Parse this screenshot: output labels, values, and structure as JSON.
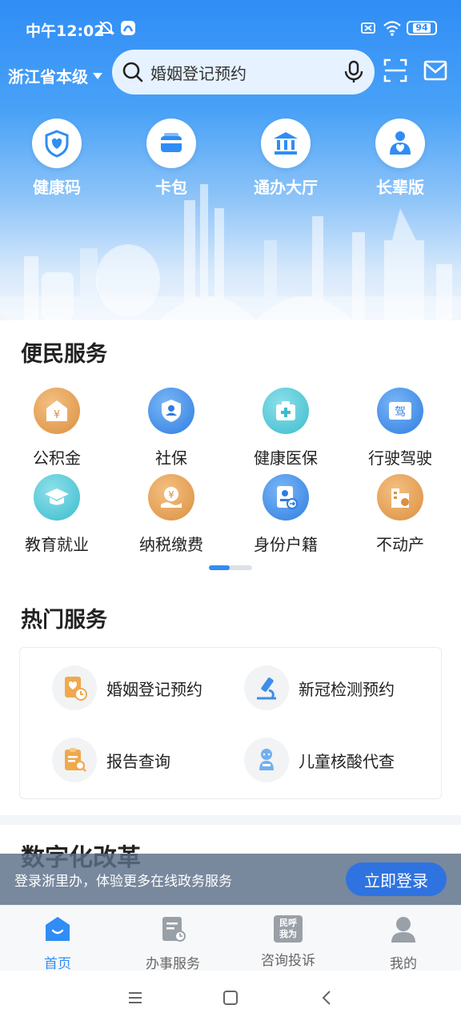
{
  "statusbar": {
    "time": "中午12:02",
    "battery": "94"
  },
  "header": {
    "region": "浙江省本级",
    "search_placeholder": "婚姻登记预约"
  },
  "quick_links": [
    {
      "label": "健康码",
      "icon": "health-code-icon"
    },
    {
      "label": "卡包",
      "icon": "card-wallet-icon"
    },
    {
      "label": "通办大厅",
      "icon": "hall-icon"
    },
    {
      "label": "长辈版",
      "icon": "elder-icon"
    }
  ],
  "convenience": {
    "title": "便民服务",
    "items": [
      {
        "label": "公积金",
        "icon": "housing-fund-icon"
      },
      {
        "label": "社保",
        "icon": "social-security-icon"
      },
      {
        "label": "健康医保",
        "icon": "medical-insurance-icon"
      },
      {
        "label": "行驶驾驶",
        "icon": "driving-icon"
      },
      {
        "label": "教育就业",
        "icon": "education-icon"
      },
      {
        "label": "纳税缴费",
        "icon": "tax-icon"
      },
      {
        "label": "身份户籍",
        "icon": "identity-icon"
      },
      {
        "label": "不动产",
        "icon": "real-estate-icon"
      }
    ]
  },
  "hot": {
    "title": "热门服务",
    "items": [
      {
        "label": "婚姻登记预约",
        "icon": "marriage-icon"
      },
      {
        "label": "新冠检测预约",
        "icon": "covid-test-icon"
      },
      {
        "label": "报告查询",
        "icon": "report-icon"
      },
      {
        "label": "儿童核酸代查",
        "icon": "child-test-icon"
      }
    ]
  },
  "digital": {
    "title": "数字化改革"
  },
  "login_banner": {
    "message": "登录浙里办，体验更多在线政务服务",
    "button": "立即登录"
  },
  "tabs": [
    {
      "label": "首页",
      "active": true
    },
    {
      "label": "办事服务"
    },
    {
      "label": "咨询投诉",
      "badge_top": "民呼",
      "badge_bottom": "我为"
    },
    {
      "label": "我的"
    }
  ],
  "colors": {
    "primary": "#2f8df5",
    "orange_icon": "#e9a253",
    "blue_icon": "#3d8ee8",
    "teal_icon": "#4cc6d8"
  }
}
